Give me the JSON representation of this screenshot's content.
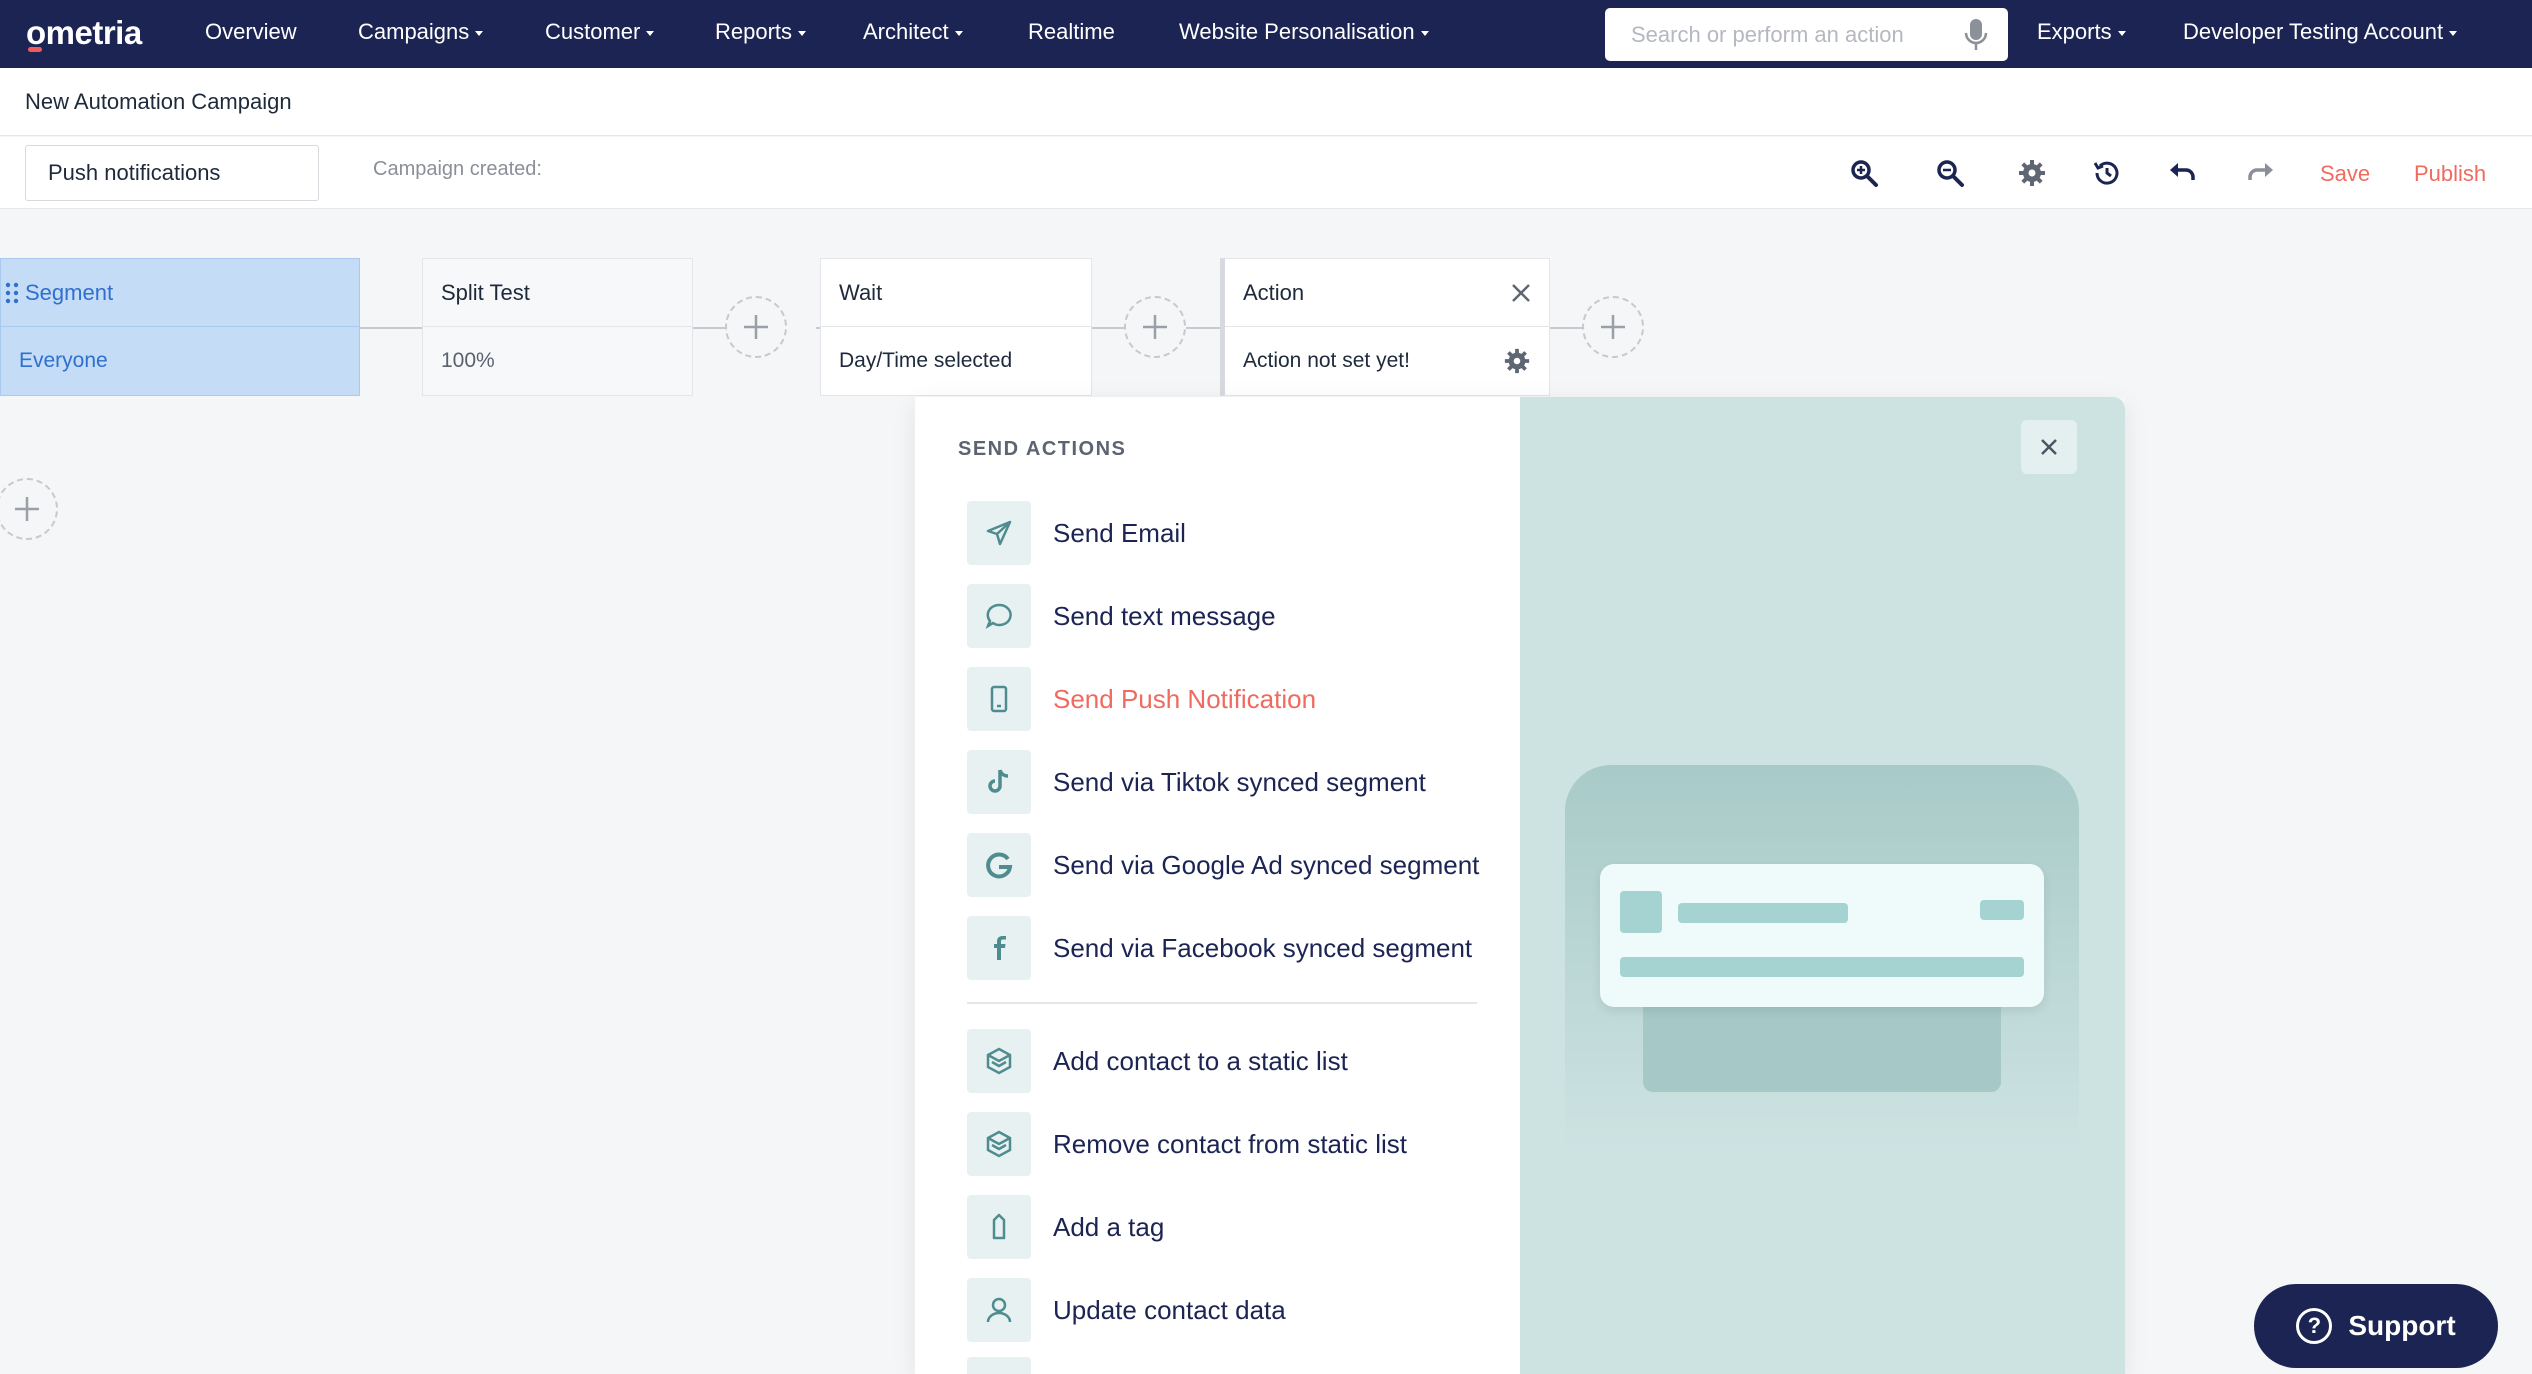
{
  "nav": {
    "logo": "ometria",
    "items": [
      {
        "label": "Overview",
        "dropdown": false
      },
      {
        "label": "Campaigns",
        "dropdown": true
      },
      {
        "label": "Customer",
        "dropdown": true
      },
      {
        "label": "Reports",
        "dropdown": true
      },
      {
        "label": "Architect",
        "dropdown": true
      },
      {
        "label": "Realtime",
        "dropdown": false
      },
      {
        "label": "Website Personalisation",
        "dropdown": true
      }
    ],
    "search_placeholder": "Search or perform an action",
    "exports": "Exports",
    "account": "Developer Testing Account"
  },
  "header": {
    "title": "New Automation Campaign"
  },
  "toolbar": {
    "campaign_name": "Push notifications",
    "campaign_created": "Campaign created:",
    "save_label": "Save",
    "publish_label": "Publish",
    "accent_color": "#ef6b5f"
  },
  "canvas": {
    "nodes": {
      "segment": {
        "title": "Segment",
        "value": "Everyone"
      },
      "split": {
        "title": "Split Test",
        "value": "100%"
      },
      "wait": {
        "title": "Wait",
        "value": "Day/Time selected"
      },
      "action": {
        "title": "Action",
        "value": "Action not set yet!"
      }
    }
  },
  "panel": {
    "heading": "SEND ACTIONS",
    "send_items": [
      {
        "label": "Send Email",
        "icon": "send-icon"
      },
      {
        "label": "Send text message",
        "icon": "chat-bubble-icon"
      },
      {
        "label": "Send Push Notification",
        "icon": "mobile-phone-icon",
        "active": true
      },
      {
        "label": "Send via Tiktok synced segment",
        "icon": "tiktok-icon"
      },
      {
        "label": "Send via Google Ad synced segment",
        "icon": "google-icon"
      },
      {
        "label": "Send via Facebook synced segment",
        "icon": "facebook-icon"
      }
    ],
    "list_items": [
      {
        "label": "Add contact to a static list",
        "icon": "layers-icon"
      },
      {
        "label": "Remove contact from static list",
        "icon": "layers-icon"
      },
      {
        "label": "Add a tag",
        "icon": "tag-icon"
      },
      {
        "label": "Update contact data",
        "icon": "user-icon"
      }
    ]
  },
  "support": {
    "label": "Support"
  }
}
